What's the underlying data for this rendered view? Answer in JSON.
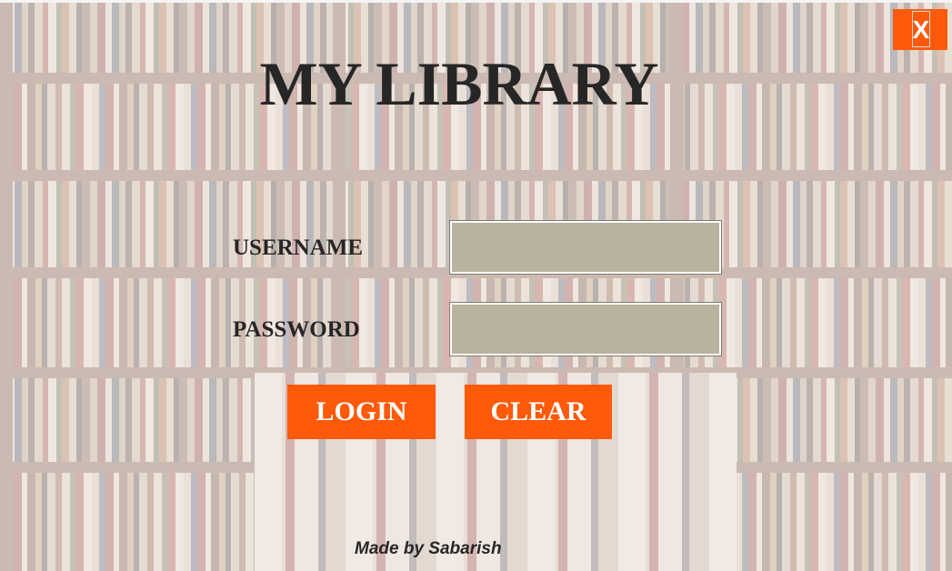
{
  "window": {
    "title": "MY LIBRARY",
    "close_label": "X"
  },
  "form": {
    "username_label": "USERNAME",
    "username_value": "",
    "password_label": "PASSWORD",
    "password_value": ""
  },
  "actions": {
    "login_label": "LOGIN",
    "clear_label": "CLEAR"
  },
  "footer": {
    "credit": "Made by Sabarish"
  },
  "colors": {
    "accent": "#ff5a0a",
    "input_fill": "#b9b29e",
    "text": "#262626"
  },
  "icons": {
    "close": "close-icon"
  }
}
